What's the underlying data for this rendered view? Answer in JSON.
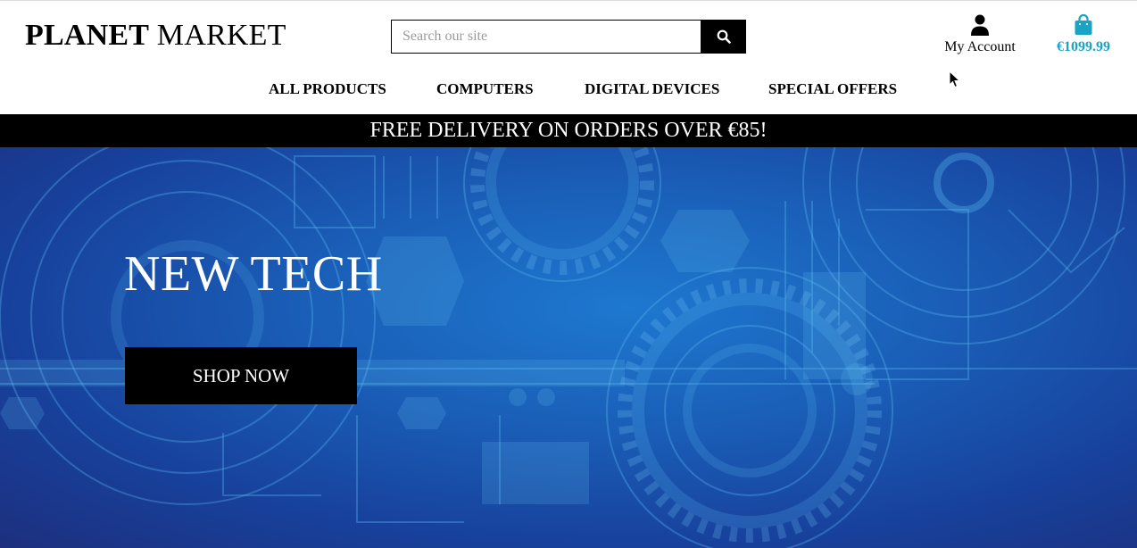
{
  "brand": {
    "name_bold": "PLANET",
    "name_rest": " MARKET"
  },
  "search": {
    "placeholder": "Search our site",
    "value": "",
    "icon": "search-icon"
  },
  "account": {
    "label": "My Account",
    "icon": "user-icon"
  },
  "bag": {
    "total": "€1099.99",
    "icon": "shopping-bag-icon"
  },
  "nav": {
    "items": [
      {
        "label": "ALL PRODUCTS"
      },
      {
        "label": "COMPUTERS"
      },
      {
        "label": "DIGITAL DEVICES"
      },
      {
        "label": "SPECIAL OFFERS"
      }
    ]
  },
  "banner": {
    "text": "FREE DELIVERY ON ORDERS OVER €85!"
  },
  "hero": {
    "title": "NEW TECH",
    "button_label": "SHOP NOW"
  },
  "colors": {
    "accent": "#1aa3c4",
    "banner_bg": "#000000",
    "hero_blue": "#1a5fb8",
    "text": "#000000"
  }
}
